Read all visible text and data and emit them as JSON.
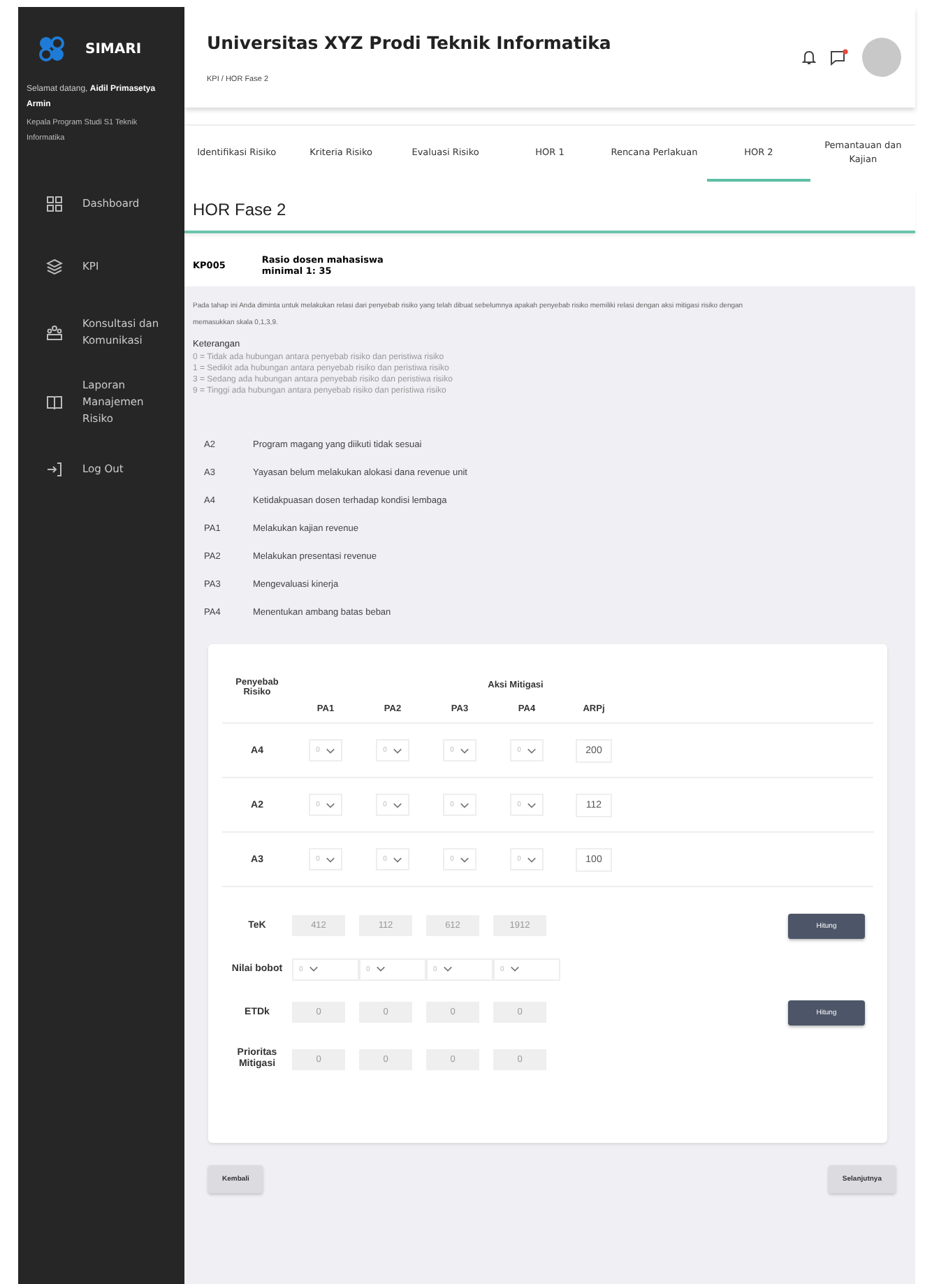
{
  "sidebar": {
    "brand": "SIMARI",
    "welcome": "Selamat datang, **Aidil Primasetya Armin**",
    "role": "Kepala Program Studi S1 Teknik Informatika",
    "items": [
      {
        "label": "Dashboard"
      },
      {
        "label": "KPI"
      },
      {
        "label": "Konsultasi dan Komunikasi"
      },
      {
        "label": "Laporan Manajemen Risiko"
      },
      {
        "label": "Log Out"
      }
    ]
  },
  "header": {
    "title": "Universitas XYZ Prodi Teknik Informatika",
    "breadcrumb": "KPI / HOR Fase 2",
    "messages_unread": true
  },
  "tabs": [
    {
      "label": "Identifikasi Risiko",
      "selected": false
    },
    {
      "label": "Kriteria Risiko",
      "selected": false
    },
    {
      "label": "Evaluasi Risiko",
      "selected": false
    },
    {
      "label": "HOR 1",
      "selected": false
    },
    {
      "label": "Rencana Perlakuan",
      "selected": false
    },
    {
      "label": "HOR 2",
      "selected": true
    },
    {
      "label": "Pemantauan dan Kajian",
      "selected": false
    }
  ],
  "page_title": "HOR Fase 2",
  "kpi": {
    "code": "KP005",
    "name": "Rasio dosen mahasiswa minimal 1: 35"
  },
  "instructions": "Pada tahap ini Anda diminta  untuk melakukan relasi dari penyebab risiko yang telah dibuat sebelumnya apakah penyebab risiko memiliki relasi dengan aksi mitigasi risiko dengan memasukkan skala 0,1,3,9.",
  "legend": {
    "title": "Keterangan",
    "lines": [
      "0 = Tidak ada hubungan antara penyebab risiko dan peristiwa risiko",
      "1 = Sedikit ada hubungan antara penyebab risiko dan peristiwa risiko",
      "3 = Sedang ada hubungan antara penyebab risiko dan peristiwa risiko",
      "9 = Tinggi ada hubungan antara penyebab risiko dan peristiwa risiko"
    ]
  },
  "codes": [
    {
      "code": "A2",
      "description": "Program magang yang diikuti tidak sesuai"
    },
    {
      "code": "A3",
      "description": "Yayasan belum melakukan alokasi dana revenue unit"
    },
    {
      "code": "A4",
      "description": "Ketidakpuasan dosen terhadap kondisi lembaga"
    },
    {
      "code": "PA1",
      "description": "Melakukan kajian revenue"
    },
    {
      "code": "PA2",
      "description": "Melakukan presentasi revenue"
    },
    {
      "code": "PA3",
      "description": "Mengevaluasi kinerja"
    },
    {
      "code": "PA4",
      "description": "Menentukan ambang batas beban"
    }
  ],
  "matrix": {
    "cause_header": "Penyebab Risiko",
    "action_header": "Aksi Mitigasi",
    "columns": [
      "PA1",
      "PA2",
      "PA3",
      "PA4"
    ],
    "arpj_header": "ARPj",
    "rows": [
      {
        "cause": "A4",
        "values": [
          "0",
          "0",
          "0",
          "0"
        ],
        "arpj": "200"
      },
      {
        "cause": "A2",
        "values": [
          "0",
          "0",
          "0",
          "0"
        ],
        "arpj": "112"
      },
      {
        "cause": "A3",
        "values": [
          "0",
          "0",
          "0",
          "0"
        ],
        "arpj": "100"
      }
    ],
    "summary": [
      {
        "kind": "values",
        "label": "TeK",
        "values": [
          "412",
          "112",
          "612",
          "1912"
        ],
        "button": "Hitung"
      },
      {
        "kind": "selects",
        "label": "Nilai bobot",
        "values": [
          "0",
          "0",
          "0",
          "0"
        ]
      },
      {
        "kind": "values",
        "label": "ETDk",
        "values": [
          "0",
          "0",
          "0",
          "0"
        ],
        "button": "Hitung"
      },
      {
        "kind": "values",
        "label": "Prioritas Mitigasi",
        "values": [
          "0",
          "0",
          "0",
          "0"
        ]
      }
    ]
  },
  "buttons": {
    "back": "Kembali",
    "next": "Selanjutnya"
  }
}
